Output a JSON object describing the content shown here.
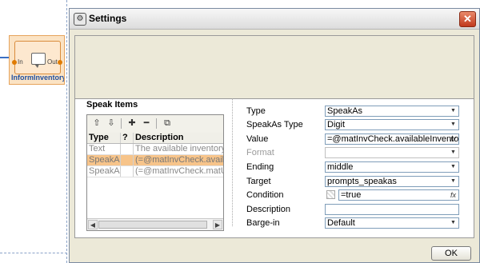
{
  "canvas": {
    "node": {
      "port_in": "In",
      "port_out": "Out",
      "label": "InformInventory"
    }
  },
  "dialog": {
    "title": "Settings",
    "close_glyph": "✕",
    "ok_label": "OK"
  },
  "speak_items": {
    "title": "Speak Items",
    "toolbar": {
      "move_up": "⇧",
      "move_down": "⇩",
      "add": "✚",
      "remove": "━",
      "copy": "⧉"
    },
    "columns": [
      "Type",
      "?",
      "Description"
    ],
    "rows": [
      {
        "type": "Text",
        "q": "",
        "description": "The available inventory is"
      },
      {
        "type": "SpeakAs",
        "q": "",
        "description": "(=@matInvCheck.available"
      },
      {
        "type": "SpeakAs",
        "q": "",
        "description": "(=@matInvCheck.matUoM"
      }
    ],
    "scroll_left": "◀",
    "scroll_right": "▶"
  },
  "properties": {
    "type": {
      "label": "Type",
      "value": "SpeakAs"
    },
    "speakas_type": {
      "label": "SpeakAs Type",
      "value": "Digit"
    },
    "value": {
      "label": "Value",
      "value": "=@matInvCheck.availableInventory"
    },
    "format": {
      "label": "Format",
      "value": ""
    },
    "ending": {
      "label": "Ending",
      "value": "middle"
    },
    "target": {
      "label": "Target",
      "value": "prompts_speakas"
    },
    "condition": {
      "label": "Condition",
      "value": "=true"
    },
    "description": {
      "label": "Description",
      "value": ""
    },
    "barge_in": {
      "label": "Barge-in",
      "value": "Default"
    },
    "dropdown_glyph": "▼",
    "fx_glyph": "fx"
  }
}
